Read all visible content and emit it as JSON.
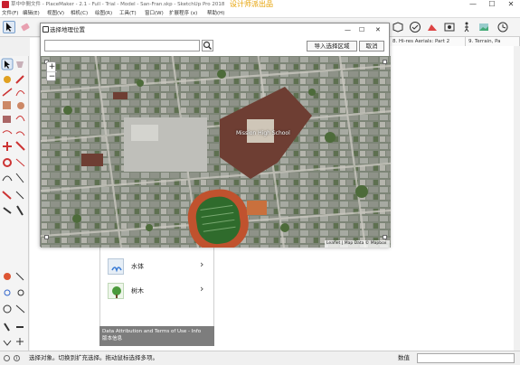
{
  "window": {
    "title": "草中中間文件 - PlaceMaker - 2.1 - Full - Trial - Model - San-Fran.skp - SketchUp Pro 2018",
    "watermark": "设计师派出品",
    "controls": {
      "minimize": "—",
      "maximize": "☐",
      "close": "✕"
    }
  },
  "menu": [
    "文件(F)",
    "编辑(E)",
    "视图(V)",
    "相机(C)",
    "绘图(R)",
    "工具(T)",
    "窗口(W)",
    "扩展程序 (x)",
    "帮助(H)"
  ],
  "scene_tabs": [
    "8. Hi-res Aerials: Part 2",
    "9. Terrain, Pa"
  ],
  "dialog": {
    "title": "选择地理位置",
    "search_placeholder": "",
    "import_button": "导入选择区域",
    "cancel_button": "取消",
    "controls": {
      "minimize": "—",
      "maximize": "☐",
      "close": "✕"
    },
    "map": {
      "zoom_in": "+",
      "zoom_out": "−",
      "place_label": "Mission High School",
      "attribution": "Leaflet | Map Data © Mapbox"
    }
  },
  "side_panel": {
    "items": [
      {
        "label": "水体",
        "icon": "water-icon"
      },
      {
        "label": "树木",
        "icon": "tree-icon"
      }
    ],
    "attribution": "Data Attribution and Terms of Use - Info",
    "attribution_link": "版本信息"
  },
  "status": {
    "message": "选择对象。切换到扩充选择。拖动鼠标选择多项。",
    "measurements_label": "数值",
    "measurements_value": ""
  },
  "colors": {
    "accent_watermark": "#e6a000",
    "track": "#c0522e",
    "field": "#2f6b2c"
  }
}
